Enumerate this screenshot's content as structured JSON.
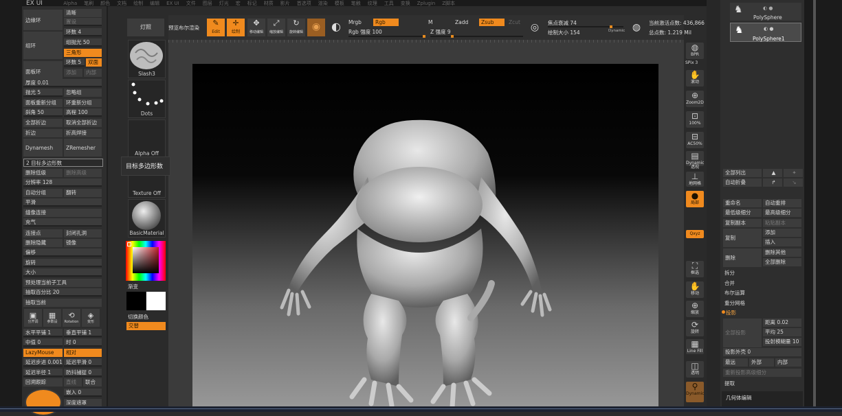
{
  "app": {
    "title": "EX UI"
  },
  "menubar": [
    "Alpha",
    "笔刷",
    "颜色",
    "文档",
    "绘制",
    "编辑",
    "EX UI",
    "文件",
    "图层",
    "灯光",
    "宏",
    "标记",
    "材质",
    "影片",
    "首选项",
    "渲染",
    "模板",
    "笔触",
    "纹理",
    "工具",
    "变换",
    "Zplugin",
    "Z脚本"
  ],
  "left_panel": {
    "edge_loop": "边缘环",
    "crease": "清晰",
    "crease_sub": "置设",
    "edge_ring": "组环",
    "loop_count": "环数 4",
    "group_smooth": "组抛光 50",
    "triangle": "三角形",
    "panel_loops": "面板环",
    "loops5": "环数 5",
    "double": "双面",
    "add": "添加",
    "inner": "内部",
    "thickness": "厚度 0.01",
    "polish": "抛光 5",
    "ignore_groups": "忽略组",
    "panel_regroup": "面板重新分组",
    "loop_regroup": "环重新分组",
    "bevel": "斜角 50",
    "height": "高程 100",
    "crease_all": "全部折边",
    "uncrease_all": "取消全部折边",
    "crease_fold": "折边",
    "elevation_weld": "折高焊接",
    "dynamesh": "Dynamesh",
    "zremesher": "ZRemesher",
    "target_polys": "2 目标多边形数",
    "delete_lower": "删除低级",
    "delete_higher": "删除高级",
    "resolution": "分辨率 128",
    "auto_groups": "自动分组",
    "flip": "翻转",
    "smooth": "平滑",
    "project_connect": "缝像连接",
    "inflate": "充气",
    "connect_points": "连接点",
    "close_holes": "封闭孔洞",
    "delete_hidden": "删除隐藏",
    "mirror": "镜像",
    "offset": "偏移",
    "rotate": "旋转",
    "size": "大小",
    "preprocess": "预处理当前子工具",
    "extract_pct": "抽取百分比 20",
    "extract_current": "抽取当前",
    "icon_btns": [
      "分开调",
      "参数设",
      "Rotation",
      "变形"
    ],
    "h_flat": "水平平铺 1",
    "v_flat": "垂直平铺 1",
    "middle": "中值 0",
    "time": "时 0",
    "lazymouse": "LazyMouse",
    "relative": "相对",
    "lazy_step": "延迟步进 0.001",
    "lazy_smooth": "延迟平滑 0",
    "lazy_radius": "延迟半径 1",
    "backtrack": "防抖捕捉 0",
    "backtrack2": "回溯跟踪",
    "line": "直线",
    "link": "联合",
    "embed": "嵌入 0",
    "depth": "深度遮罩"
  },
  "shelf": {
    "lights": "灯照",
    "preview_boolean": "预览布尔渲染",
    "brush": "Slash3",
    "stroke": "Dots",
    "alpha": "Alpha Off",
    "texture": "Texture Off",
    "material": "BasicMaterial",
    "gradient": "渐变",
    "switch_color": "切换颜色",
    "swap": "交替"
  },
  "tooltip": {
    "text": "目标多边形数"
  },
  "topbar": {
    "edit": "Edit",
    "draw": "绘制",
    "move": "移动编辑",
    "scale": "缩放编辑",
    "rotate": "旋转编辑",
    "mrgb": "Mrgb",
    "rgb": "Rgb",
    "m": "M",
    "zadd": "Zadd",
    "zsub": "Zsub",
    "zcut": "Zcut",
    "rgb_intensity": "Rgb 强度 100",
    "z_intensity": "Z 强度 9",
    "focal_shift": "焦点衰减 74",
    "draw_size": "绘制大小 154",
    "dynamic": "Dynamic",
    "active_points": "当前激活点数: 436,866",
    "total_points": "总点数: 1.219 Mil"
  },
  "right_strip": [
    {
      "icon": "bpr-icon",
      "label": "BPR"
    },
    {
      "icon": "spix-icon",
      "label": "SPix 3"
    },
    {
      "icon": "scroll-icon",
      "label": "滚动"
    },
    {
      "icon": "zoom2d-icon",
      "label": "Zoom2D"
    },
    {
      "icon": "zoom100-icon",
      "label": "100%"
    },
    {
      "icon": "ac50-icon",
      "label": "AC50%"
    },
    {
      "icon": "dynamic-persp-icon",
      "label": "Dynamic 透视"
    },
    {
      "icon": "floor-icon",
      "label": "地网格"
    },
    {
      "icon": "local-icon",
      "label": "局部"
    },
    {
      "icon": "xyz-icon",
      "label": "Qxyz"
    },
    {
      "icon": "frame-icon",
      "label": "框选"
    },
    {
      "icon": "move-icon",
      "label": "移动"
    },
    {
      "icon": "zoom3d-icon",
      "label": "缩放"
    },
    {
      "icon": "rotate-icon",
      "label": "旋转"
    },
    {
      "icon": "linefill-icon",
      "label": "Line Fill"
    },
    {
      "icon": "transp-icon",
      "label": "透明"
    },
    {
      "icon": "dynamic-icon",
      "label": "Dynamic"
    }
  ],
  "right_panel": {
    "subtools": [
      "PolySphere",
      "PolySphere1"
    ],
    "list_all": "全部列出",
    "auto_collapse": "自动折叠",
    "rename": "重命名",
    "auto_reorder": "自动重排",
    "lowest_sub": "最低级细分",
    "highest_sub": "最高级细分",
    "copy_sub": "复制副本",
    "paste_copy": "粘贴副本",
    "duplicate": "复制",
    "append": "添加",
    "insert": "插入",
    "delete": "删除",
    "delete_other": "删除其他",
    "delete_all": "全部删除",
    "split": "拆分",
    "merge": "合并",
    "boolean": "布尔运算",
    "remesh": "重分网格",
    "project": "投影",
    "project_all": "全部投影",
    "distance": "距离 0.02",
    "mean": "平均 25",
    "pa_blur": "投射模糊量 10",
    "project_shell": "投影外壳 0",
    "farthest": "最远",
    "outer": "外部",
    "inner": "内部",
    "reproject": "重新投影高级细分",
    "extract": "提取",
    "geometry": "几何体编辑"
  }
}
